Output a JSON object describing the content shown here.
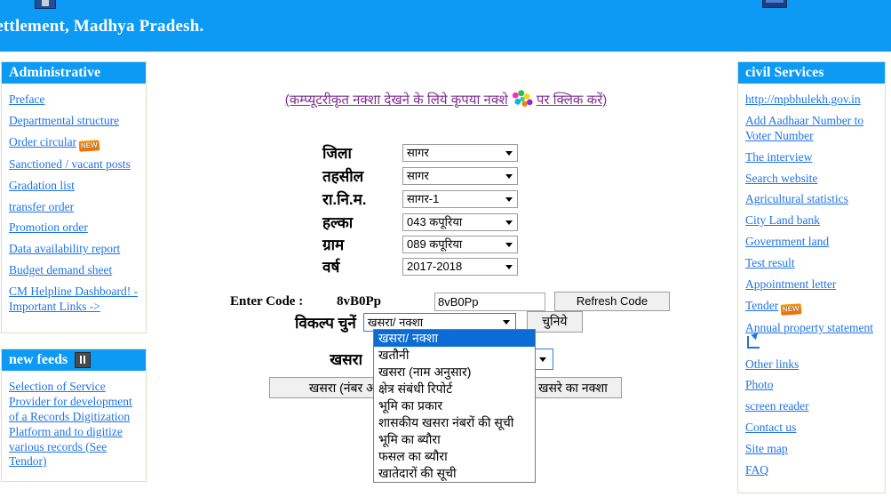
{
  "banner": {
    "title": "nd Settlement, Madhya Pradesh.",
    "left_logo": "emblem-icon",
    "right_logo": "emblem-icon"
  },
  "left_panel": {
    "heading": "Administrative",
    "links": [
      {
        "label": "Preface",
        "badge": null
      },
      {
        "label": "Departmental structure",
        "badge": null
      },
      {
        "label": "Order circular",
        "badge": "NEW"
      },
      {
        "label": "Sanctioned / vacant posts",
        "badge": null
      },
      {
        "label": "Gradation list",
        "badge": null
      },
      {
        "label": "transfer order",
        "badge": null
      },
      {
        "label": "Promotion order",
        "badge": null
      },
      {
        "label": "Data availability report",
        "badge": null
      },
      {
        "label": "Budget demand sheet",
        "badge": null
      },
      {
        "label": "CM Helpline Dashboard! - Important Links ->",
        "badge": null
      }
    ]
  },
  "feeds_panel": {
    "heading": "new feeds",
    "pause_icon": "pause-icon",
    "links": [
      {
        "label": "Selection of Service Provider for development of a Records Digitization Platform and to digitize various records (See Tendor)"
      }
    ]
  },
  "right_panel": {
    "heading": "civil Services",
    "links": [
      {
        "label": "http://mpbhulekh.gov.in",
        "badge": null,
        "external": false
      },
      {
        "label": "Add Aadhaar Number to Voter Number",
        "badge": null,
        "external": false
      },
      {
        "label": "The interview",
        "badge": null,
        "external": false
      },
      {
        "label": "Search website",
        "badge": null,
        "external": false
      },
      {
        "label": "Agricultural statistics",
        "badge": null,
        "external": false
      },
      {
        "label": "City Land bank",
        "badge": null,
        "external": false
      },
      {
        "label": "Government land",
        "badge": null,
        "external": false
      },
      {
        "label": "Test result",
        "badge": null,
        "external": false
      },
      {
        "label": "Appointment letter",
        "badge": null,
        "external": false
      },
      {
        "label": "Tender",
        "badge": "NEW",
        "external": false
      },
      {
        "label": "Annual property statement ",
        "badge": null,
        "external": true
      },
      {
        "label": "Other links",
        "badge": null,
        "external": false
      },
      {
        "label": "Photo",
        "badge": null,
        "external": false
      },
      {
        "label": "screen reader",
        "badge": null,
        "external": false
      },
      {
        "label": "Contact us",
        "badge": null,
        "external": false
      },
      {
        "label": "Site map",
        "badge": null,
        "external": false
      },
      {
        "label": "FAQ",
        "badge": null,
        "external": false
      }
    ]
  },
  "main": {
    "map_note_before": "(कम्प्यूटरीकृत नक्शा देखने के लिये कृपया नक्शे",
    "map_note_after": "पर क्लिक करें)",
    "map_icon": "madhya-pradesh-map-icon",
    "fields": [
      {
        "label": "जिला",
        "value": "सागर",
        "name": "district"
      },
      {
        "label": "तहसील",
        "value": "सागर",
        "name": "tehsil"
      },
      {
        "label": "रा.नि.म.",
        "value": "सागर-1",
        "name": "ranim"
      },
      {
        "label": "हल्का",
        "value": "043 कपूरिया",
        "name": "halka"
      },
      {
        "label": "ग्राम",
        "value": "089 कपूरिया",
        "name": "village"
      },
      {
        "label": "वर्ष",
        "value": "2017-2018",
        "name": "year"
      }
    ],
    "captcha": {
      "label": "Enter Code :",
      "code_image_text": "8vB0Pp",
      "input_value": "8vB0Pp",
      "refresh_label": "Refresh Code"
    },
    "option": {
      "label": "विकल्प चुनें",
      "selected": "खसरा/ नक्शा",
      "submit_label": "चुनिये",
      "items": [
        "खसरा/ नक्शा",
        "खतौनी",
        "खसरा (नाम अनुसार)",
        "क्षेत्र संबंधी रिपोर्ट",
        "भूमि का प्रकार",
        "शासकीय खसरा नंबरों की सूची",
        "भूमि का ब्यौरा",
        "फसल का ब्यौरा",
        "खातेदारों की सूची"
      ],
      "selected_index": 0
    },
    "behind": {
      "label": "खसरा",
      "btn_khasra_number": "खसरा (नंबर अनुसार)",
      "btn_khasra_map": "खसरे का नक्शा"
    }
  },
  "colors": {
    "brand_blue": "#0c9af5",
    "link_blue": "#1e73e8",
    "panel_border": "#d7e3c2",
    "highlight_blue": "#0a6cd4",
    "note_purple": "#8b1a6b"
  }
}
